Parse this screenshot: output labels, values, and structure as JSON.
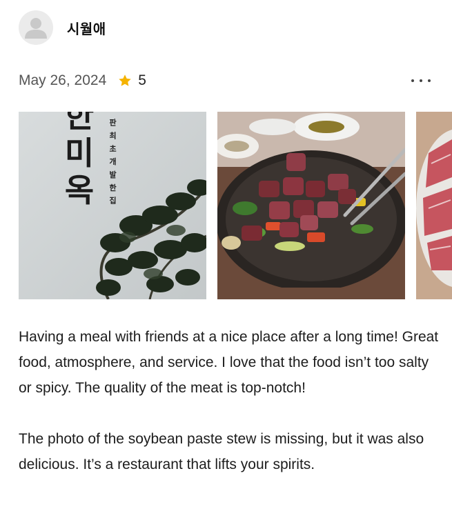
{
  "review": {
    "username": "시월애",
    "date": "May 26, 2024",
    "rating": "5",
    "photo1_sign": {
      "big_chars": [
        "한",
        "미",
        "옥"
      ],
      "small_text": "판 최 초 개 발 한 집"
    },
    "paragraphs": [
      "Having a meal with friends at a nice place after a long time! Great food, atmosphere, and service. I love that the food isn’t too salty or spicy. The quality of the meat is top-notch!",
      "The photo of the soybean paste stew is missing, but it was also delicious. It’s a restaurant that lifts your spirits."
    ]
  },
  "icons": {
    "avatar": "person-icon",
    "star": "star-icon",
    "more": "more-horizontal-icon"
  },
  "colors": {
    "star": "#f5b301",
    "avatar_bg": "#ebebeb",
    "meta_text": "#555555"
  }
}
